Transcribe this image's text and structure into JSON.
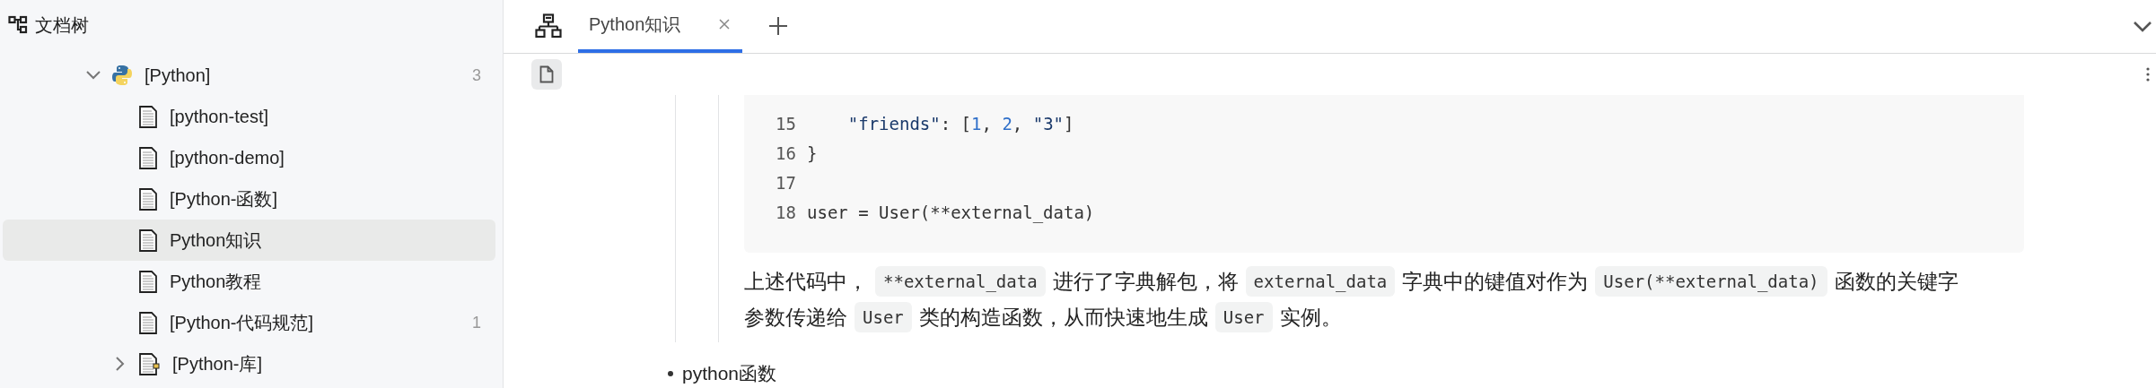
{
  "sidebar": {
    "title": "文档树",
    "tree": [
      {
        "label": "[Python]",
        "kind": "python",
        "count": "3",
        "expanded": true,
        "selected": false,
        "children": [
          {
            "label": "[python-test]",
            "kind": "doc",
            "selected": false
          },
          {
            "label": "[python-demo]",
            "kind": "doc",
            "selected": false
          },
          {
            "label": "[Python-函数]",
            "kind": "doc",
            "selected": false
          },
          {
            "label": "Python知识",
            "kind": "doc",
            "selected": true
          },
          {
            "label": "Python教程",
            "kind": "doc",
            "selected": false
          },
          {
            "label": "[Python-代码规范]",
            "kind": "doc",
            "count": "1",
            "selected": false
          },
          {
            "label": "[Python-库]",
            "kind": "folder",
            "expanded": false,
            "selected": false
          }
        ]
      }
    ]
  },
  "tabs": [
    {
      "label": "Python知识",
      "selected": true
    }
  ],
  "code_block": {
    "lines": [
      {
        "number": "15",
        "tokens": [
          {
            "kind": "string",
            "text": "    \"friends\""
          },
          {
            "kind": "plain",
            "text": ": ["
          },
          {
            "kind": "number",
            "text": "1"
          },
          {
            "kind": "plain",
            "text": ", "
          },
          {
            "kind": "number",
            "text": "2"
          },
          {
            "kind": "plain",
            "text": ", "
          },
          {
            "kind": "string",
            "text": "\"3\""
          },
          {
            "kind": "plain",
            "text": "]"
          }
        ]
      },
      {
        "number": "16",
        "tokens": [
          {
            "kind": "plain",
            "text": "}"
          }
        ]
      },
      {
        "number": "17"
      },
      {
        "number": "18",
        "tokens": [
          {
            "kind": "plain",
            "text": "user = User(**external_data)"
          }
        ]
      }
    ]
  },
  "paragraph": {
    "lines": [
      [
        {
          "kind": "text",
          "text": "上述代码中，"
        },
        {
          "kind": "code",
          "text": "**external_data"
        },
        {
          "kind": "text",
          "text": "进行了字典解包，将"
        },
        {
          "kind": "code",
          "text": "external_data"
        },
        {
          "kind": "text",
          "text": "字典中的键值对作为"
        },
        {
          "kind": "code",
          "text": "User(**external_data)"
        },
        {
          "kind": "text",
          "text": "函数的关键字"
        }
      ],
      [
        {
          "kind": "text",
          "text": "参数传递给"
        },
        {
          "kind": "code",
          "text": "User"
        },
        {
          "kind": "text",
          "text": "类的构造函数，从而快速地生成"
        },
        {
          "kind": "code",
          "text": "User"
        },
        {
          "kind": "text",
          "text": "实例。"
        }
      ]
    ]
  },
  "bullet": {
    "text": "python函数"
  }
}
